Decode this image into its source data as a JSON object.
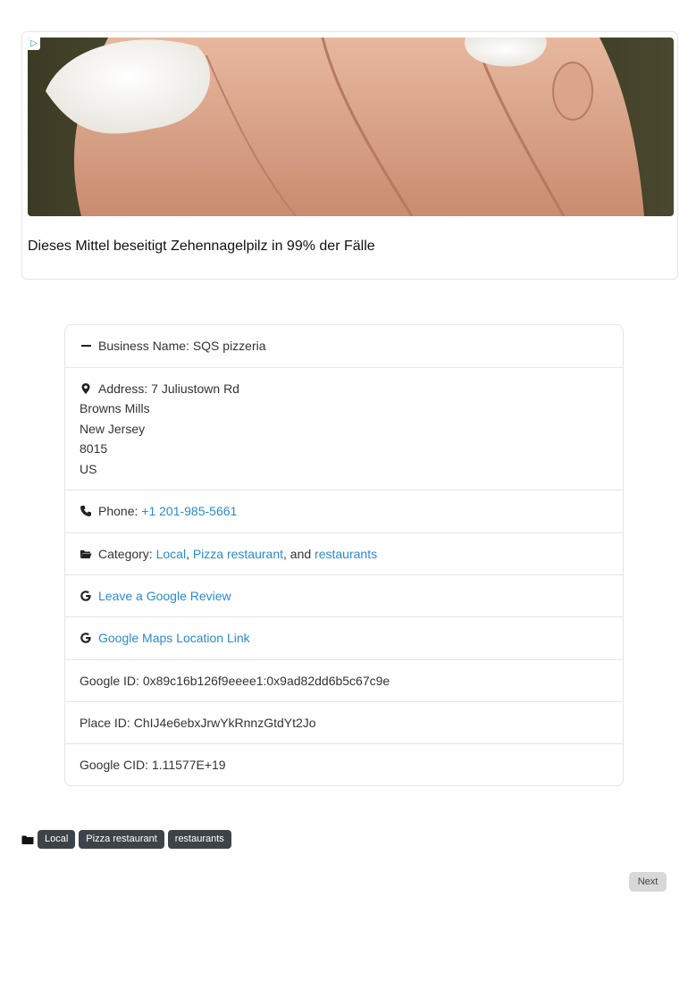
{
  "ad": {
    "headline": "Dieses Mittel beseitigt Zehennagelpilz in 99% der Fälle",
    "ad_choice_icon": "adchoices-icon"
  },
  "business": {
    "name_label": "Business Name:",
    "name": "SQS pizzeria",
    "address_label": "Address:",
    "address_street": "7 Juliustown Rd",
    "address_city": "Browns Mills",
    "address_state": "New Jersey",
    "address_zip": "8015",
    "address_country": "US",
    "phone_label": "Phone:",
    "phone": "+1 201-985-5661",
    "category_label": "Category:",
    "categories": [
      "Local",
      "Pizza restaurant",
      "restaurants"
    ],
    "category_sep1": ",",
    "category_sep2": ", and",
    "review_link": "Leave a Google Review",
    "maps_link": "Google Maps Location Link",
    "google_id_label": "Google ID:",
    "google_id": "0x89c16b126f9eeee1:0x9ad82dd6b5c67c9e",
    "place_id_label": "Place ID:",
    "place_id": "ChIJ4e6ebxJrwYkRnnzGtdYt2Jo",
    "cid_label": "Google CID:",
    "cid": "1.11577E+19"
  },
  "tags": [
    "Local",
    "Pizza restaurant",
    "restaurants"
  ],
  "pagination": {
    "next_label": "Next"
  },
  "colors": {
    "link": "#2a8bd0",
    "tag_bg": "#3d4449"
  }
}
